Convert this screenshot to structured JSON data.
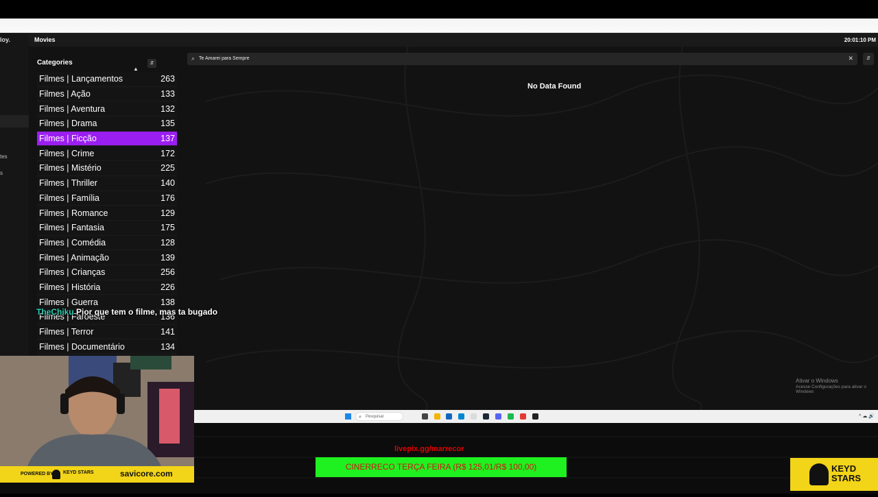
{
  "app": {
    "logo_text": "loy.",
    "page_title": "Movies",
    "clock": "20:01:10 PM",
    "rail_labels": [
      "tes",
      "s"
    ]
  },
  "categories": {
    "title": "Categories",
    "sort_icon": "sort-icon",
    "items": [
      {
        "label": "Filmes | Lançamentos",
        "count": "263"
      },
      {
        "label": "Filmes | Ação",
        "count": "133"
      },
      {
        "label": "Filmes | Aventura",
        "count": "132"
      },
      {
        "label": "Filmes | Drama",
        "count": "135"
      },
      {
        "label": "Filmes | Ficção",
        "count": "137",
        "active": true
      },
      {
        "label": "Filmes | Crime",
        "count": "172"
      },
      {
        "label": "Filmes | Mistério",
        "count": "225"
      },
      {
        "label": "Filmes | Thriller",
        "count": "140"
      },
      {
        "label": "Filmes | Família",
        "count": "176"
      },
      {
        "label": "Filmes | Romance",
        "count": "129"
      },
      {
        "label": "Filmes | Fantasia",
        "count": "175"
      },
      {
        "label": "Filmes | Comédia",
        "count": "128"
      },
      {
        "label": "Filmes | Animação",
        "count": "139"
      },
      {
        "label": "Filmes | Crianças",
        "count": "256"
      },
      {
        "label": "Filmes | História",
        "count": "226"
      },
      {
        "label": "Filmes | Guerra",
        "count": "138"
      },
      {
        "label": "Filmes | Faroeste",
        "count": "136"
      },
      {
        "label": "Filmes | Terror",
        "count": "141"
      },
      {
        "label": "Filmes | Documentário",
        "count": "134"
      }
    ],
    "active_color": "#9b1ef0"
  },
  "search": {
    "value": "Te Amarei para Sempre",
    "clear_icon": "close-icon"
  },
  "content": {
    "empty_message": "No Data Found"
  },
  "windows_watermark": {
    "line1": "Ativar o Windows",
    "line2": "Acesse Configurações para ativar o Windows"
  },
  "chat": {
    "user": "TheChiku",
    "message": "Pior que tem o filme, mas ta bugado"
  },
  "taskbar": {
    "search_placeholder": "Pesquisar"
  },
  "stream_overlay": {
    "livepix": "livepix.gg/marrecor",
    "goal_text": "CINERRECO TERÇA FEIRA (R$ 125,01/R$ 100,00)",
    "goal_color": "#1ff01f",
    "sponsor_brand": "KEYD STARS",
    "powered_by": "POWERED BY",
    "sponsor_site": "savicore.com"
  }
}
